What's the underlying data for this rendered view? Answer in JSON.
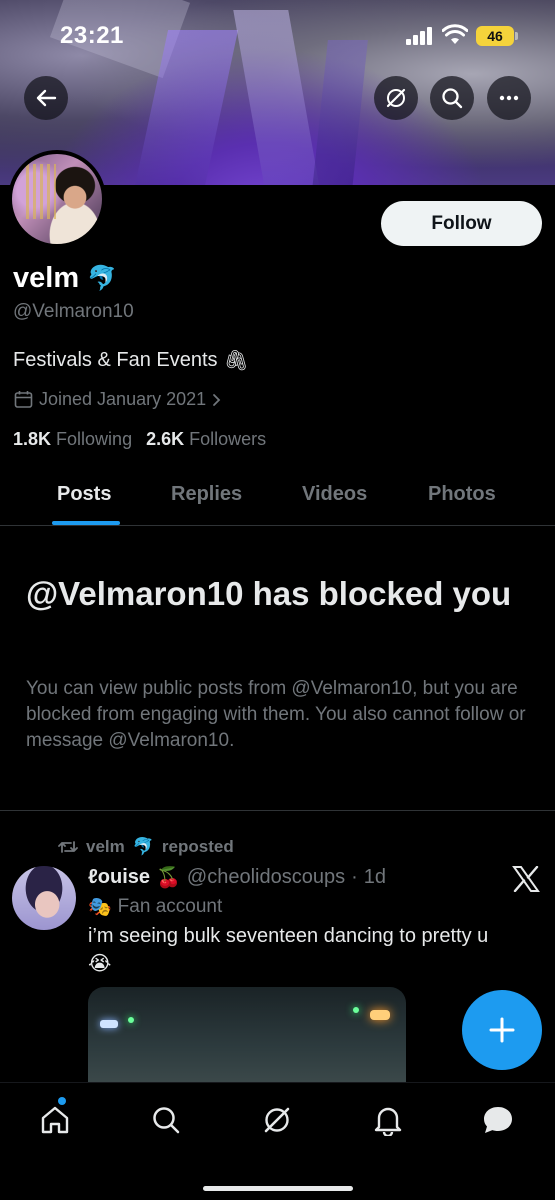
{
  "status_bar": {
    "time": "23:21",
    "battery": "46"
  },
  "profile": {
    "display_name": "velm",
    "name_emoji": "🐬",
    "handle": "@Velmaron10",
    "bio": "Festivals & Fan Events",
    "bio_emoji": "🖇",
    "joined": "Joined January 2021",
    "following_count": "1.8K",
    "following_label": "Following",
    "followers_count": "2.6K",
    "followers_label": "Followers",
    "follow_button": "Follow"
  },
  "tabs": [
    {
      "label": "Posts",
      "active": true
    },
    {
      "label": "Replies",
      "active": false
    },
    {
      "label": "Videos",
      "active": false
    },
    {
      "label": "Photos",
      "active": false
    }
  ],
  "blocked": {
    "title": "@Velmaron10 has blocked you",
    "body": "You can view public posts from @Velmaron10, but you are blocked from engaging with them. You also cannot follow or message @Velmaron10."
  },
  "post": {
    "repost_by": "velm",
    "repost_emoji": "🐬",
    "repost_label": "reposted",
    "author_name": "ℓouise",
    "author_emoji": "🍒",
    "author_handle": "@cheolidoscoups",
    "separator": "·",
    "time": "1d",
    "label_emoji": "🎭",
    "label": "Fan account",
    "text": "i’m seeing bulk seventeen dancing to pretty u",
    "text_emoji": "😭"
  },
  "colors": {
    "accent": "#1d9bf0",
    "muted": "#71767b",
    "text": "#e7e9ea",
    "battery": "#f5d33b"
  },
  "icons": {
    "back": "arrow-left-icon",
    "grok": "grok-icon",
    "search": "search-icon",
    "more": "more-horizontal-icon",
    "calendar": "calendar-icon",
    "repost": "repost-icon",
    "x_logo": "x-logo-icon",
    "compose": "plus-icon",
    "nav": [
      "home-icon",
      "search-icon",
      "grok-icon",
      "bell-icon",
      "messages-icon"
    ]
  }
}
